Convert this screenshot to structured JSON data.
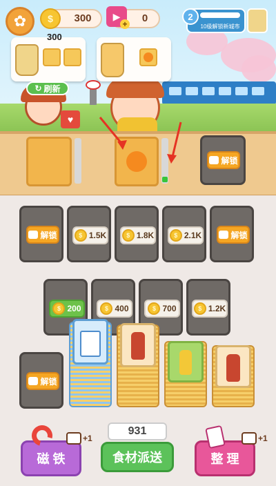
{
  "hud": {
    "coin_value": "300",
    "ticket_value": "0",
    "level_number": "2",
    "level_text": "10级解锁新城市"
  },
  "customers": {
    "left_price": "300",
    "refresh_label": "刷新"
  },
  "shelves": {
    "unlock_label": "解锁"
  },
  "grid": {
    "row1": [
      {
        "type": "lock",
        "label": "解锁"
      },
      {
        "type": "price",
        "label": "1.5K"
      },
      {
        "type": "price",
        "label": "1.8K"
      },
      {
        "type": "price",
        "label": "2.1K"
      },
      {
        "type": "lock",
        "label": "解锁"
      }
    ],
    "row2": [
      {
        "type": "price",
        "label": "200",
        "green": true
      },
      {
        "type": "price",
        "label": "400"
      },
      {
        "type": "price",
        "label": "700"
      },
      {
        "type": "price",
        "label": "1.2K"
      }
    ],
    "row3_lock": "解锁"
  },
  "bottom": {
    "magnet_label": "磁 铁",
    "magnet_bonus": "+1",
    "deliver_count": "931",
    "deliver_label": "食材派送",
    "sort_label": "整 理",
    "sort_bonus": "+1"
  },
  "colors": {
    "lock_orange": "#f5a623",
    "green_price": "#6dc24a",
    "magnet_purple": "#b86ad8",
    "deliver_green": "#5cc25a",
    "sort_pink": "#e8579a"
  }
}
